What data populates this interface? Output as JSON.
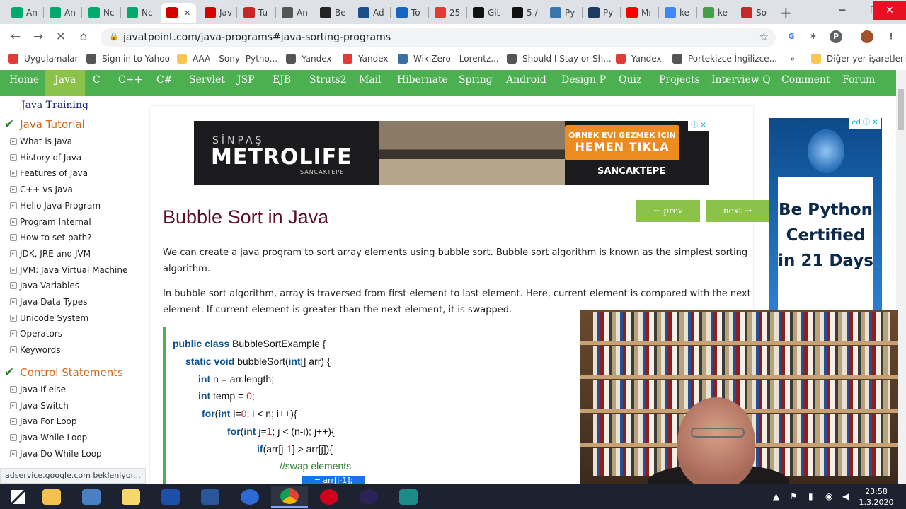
{
  "tabs": [
    {
      "label": "An",
      "icon": "w3-icon",
      "color": "#04aa6d"
    },
    {
      "label": "An",
      "icon": "w3-icon",
      "color": "#04aa6d"
    },
    {
      "label": "Nc",
      "icon": "w3-icon",
      "color": "#04aa6d"
    },
    {
      "label": "Nc",
      "icon": "w3-icon",
      "color": "#04aa6d"
    },
    {
      "label": "",
      "icon": "javatpoint-icon",
      "color": "#d50000",
      "active": true
    },
    {
      "label": "Jav",
      "icon": "javatpoint-icon",
      "color": "#d50000"
    },
    {
      "label": "Tu",
      "icon": "bookmark-icon",
      "color": "#c62828"
    },
    {
      "label": "An",
      "icon": "diamond-icon",
      "color": "#555555"
    },
    {
      "label": "Be",
      "icon": "a-icon",
      "color": "#222222"
    },
    {
      "label": "Ad",
      "icon": "globe-icon",
      "color": "#1a4f8a"
    },
    {
      "label": "To",
      "icon": "e-icon",
      "color": "#1565c0"
    },
    {
      "label": "25",
      "icon": "pen-icon",
      "color": "#e53935"
    },
    {
      "label": "Git",
      "icon": "github-icon",
      "color": "#111111"
    },
    {
      "label": "5 /",
      "icon": "m-icon",
      "color": "#111111"
    },
    {
      "label": "Py",
      "icon": "python-icon",
      "color": "#3776ab"
    },
    {
      "label": "Py",
      "icon": "sf-icon",
      "color": "#1e3a5f"
    },
    {
      "label": "Mı",
      "icon": "youtube-icon",
      "color": "#ff0000"
    },
    {
      "label": "ke",
      "icon": "google-icon",
      "color": "#4285f4"
    },
    {
      "label": "ke",
      "icon": "drop-icon",
      "color": "#43a047"
    },
    {
      "label": "So",
      "icon": "h-icon",
      "color": "#c62828"
    }
  ],
  "window": {
    "minimize": "─",
    "maximize": "❐",
    "close": "✕",
    "new_tab": "+"
  },
  "omnibox": {
    "url": "javatpoint.com/java-programs#java-sorting-programs"
  },
  "bookmarks": [
    {
      "label": "Uygulamalar",
      "color": "#e53935"
    },
    {
      "label": "Sign in to Yahoo",
      "color": "#555555"
    },
    {
      "label": "AAA - Sony- Pytho...",
      "color": "#f9c74f"
    },
    {
      "label": "Yandex",
      "color": "#555555"
    },
    {
      "label": "Yandex",
      "color": "#e53935"
    },
    {
      "label": "WikiZero - Lorentz...",
      "color": "#3a6ea5"
    },
    {
      "label": "Should I Stay or Sh...",
      "color": "#555555"
    },
    {
      "label": "Yandex",
      "color": "#e53935"
    },
    {
      "label": "Portekizce İngilizce...",
      "color": "#555555"
    }
  ],
  "bookmarks_more": "»",
  "bookmarks_other": "Diğer yer işaretleri",
  "menu": [
    "Home",
    "Java",
    "C",
    "C++",
    "C#",
    "Servlet",
    "JSP",
    "EJB",
    "Struts2",
    "Mail",
    "Hibernate",
    "Spring",
    "Android",
    "Design P",
    "Quiz",
    "Projects",
    "Interview Q",
    "Comment",
    "Forum"
  ],
  "sidebar": {
    "title": "Java Training",
    "sections": [
      {
        "heading": "Java Tutorial",
        "items": [
          "What is Java",
          "History of Java",
          "Features of Java",
          "C++ vs Java",
          "Hello Java Program",
          "Program Internal",
          "How to set path?",
          "JDK, JRE and JVM",
          "JVM: Java Virtual Machine",
          "Java Variables",
          "Java Data Types",
          "Unicode System",
          "Operators",
          "Keywords"
        ]
      },
      {
        "heading": "Control Statements",
        "items": [
          "Java If-else",
          "Java Switch",
          "Java For Loop",
          "Java While Loop",
          "Java Do While Loop"
        ]
      }
    ]
  },
  "ad_banner": {
    "brand_top": "SİNPAŞ",
    "brand_main": "METROLIFE",
    "brand_sub": "SANCAKTEPE",
    "cta_line1": "ÖRNEK EVİ GEZMEK İÇİN",
    "cta_line2": "HEMEN TIKLA",
    "location": "SANCAKTEPE",
    "ad_mark": "ⓘ ✕"
  },
  "pager": {
    "prev": "← prev",
    "next": "next →"
  },
  "page": {
    "title": "Bubble Sort in Java",
    "para1": "We can create a java program to sort array elements using bubble sort. Bubble sort algorithm is known as the simplest sorting algorithm.",
    "para2": "In bubble sort algorithm, array is traversed from first element to last element. Here, current element is compared with the next element. If current element is greater than the next element, it is swapped."
  },
  "code": [
    {
      "indent": 14,
      "parts": [
        [
          "kw",
          "public class "
        ],
        [
          "",
          "BubbleSortExample {"
        ]
      ]
    },
    {
      "indent": 32,
      "parts": [
        [
          "kw",
          "static void "
        ],
        [
          "",
          "bubbleSort("
        ],
        [
          "kw",
          "int"
        ],
        [
          "",
          "[] arr) {"
        ]
      ]
    },
    {
      "indent": 50,
      "parts": [
        [
          "kw",
          "int "
        ],
        [
          "",
          "n = arr.length;"
        ]
      ]
    },
    {
      "indent": 50,
      "parts": [
        [
          "kw",
          "int "
        ],
        [
          "",
          "temp = "
        ],
        [
          "num",
          "0"
        ],
        [
          "",
          ";"
        ]
      ]
    },
    {
      "indent": 55,
      "parts": [
        [
          "kw",
          "for"
        ],
        [
          "",
          "("
        ],
        [
          "kw",
          "int "
        ],
        [
          "",
          "i="
        ],
        [
          "num",
          "0"
        ],
        [
          "",
          "; i < n; i++){"
        ]
      ]
    },
    {
      "indent": 91,
      "parts": [
        [
          "kw",
          "for"
        ],
        [
          "",
          "("
        ],
        [
          "kw",
          "int "
        ],
        [
          "",
          "j="
        ],
        [
          "num",
          "1"
        ],
        [
          "",
          "; j < (n-i); j++){"
        ]
      ]
    },
    {
      "indent": 133,
      "parts": [
        [
          "kw",
          "if"
        ],
        [
          "",
          "(arr[j-"
        ],
        [
          "num",
          "1"
        ],
        [
          "",
          "] > arr[j]){"
        ]
      ]
    },
    {
      "indent": 165,
      "parts": [
        [
          "cm",
          "//swap elements"
        ]
      ]
    }
  ],
  "code_selection": "= arr[j-1];",
  "right_ad": {
    "line1": "Be Python",
    "line2": "Certified",
    "line3": "in 21 Days",
    "ad_mark": "ed ⓘ ✕"
  },
  "status_text": "adservice.google.com bekleniyor...",
  "taskbar": {
    "time": "23:58",
    "date": "1.3.2020"
  },
  "colors": {
    "menu_green": "#4caf50",
    "accent_green": "#8bc34a",
    "title_maroon": "#5c0f28",
    "sidebar_heading": "#d2691e"
  }
}
